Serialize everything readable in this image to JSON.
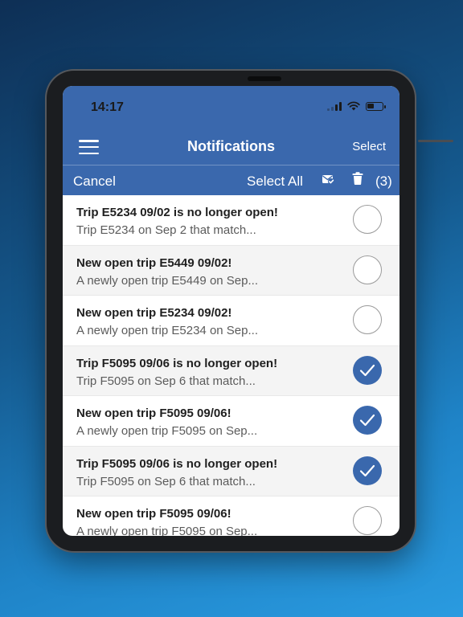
{
  "colors": {
    "header_blue": "#3a68ad",
    "check_blue": "#3a68ad",
    "alt_row": "#f4f4f4"
  },
  "status": {
    "time": "14:17"
  },
  "nav": {
    "title": "Notifications",
    "select_label": "Select",
    "menu_icon": "hamburger-icon"
  },
  "toolbar": {
    "cancel_label": "Cancel",
    "select_all_label": "Select All",
    "mark_read_icon": "envelope-check-icon",
    "delete_icon": "trash-icon",
    "selected_count": "(3)"
  },
  "notifications": [
    {
      "title": "Trip E5234 09/02 is no longer open!",
      "subtitle": "Trip E5234 on Sep 2 that match...",
      "selected": false
    },
    {
      "title": "New open trip E5449 09/02!",
      "subtitle": "A newly open trip E5449 on Sep...",
      "selected": false
    },
    {
      "title": "New open trip E5234 09/02!",
      "subtitle": "A newly open trip E5234 on Sep...",
      "selected": false
    },
    {
      "title": "Trip F5095 09/06 is no longer open!",
      "subtitle": "Trip F5095 on Sep 6 that match...",
      "selected": true
    },
    {
      "title": "New open trip F5095 09/06!",
      "subtitle": "A newly open trip F5095 on Sep...",
      "selected": true
    },
    {
      "title": "Trip F5095 09/06 is no longer open!",
      "subtitle": "Trip F5095 on Sep 6 that match...",
      "selected": true
    },
    {
      "title": "New open trip F5095 09/06!",
      "subtitle": "A newly open trip F5095 on Sep...",
      "selected": false
    }
  ]
}
